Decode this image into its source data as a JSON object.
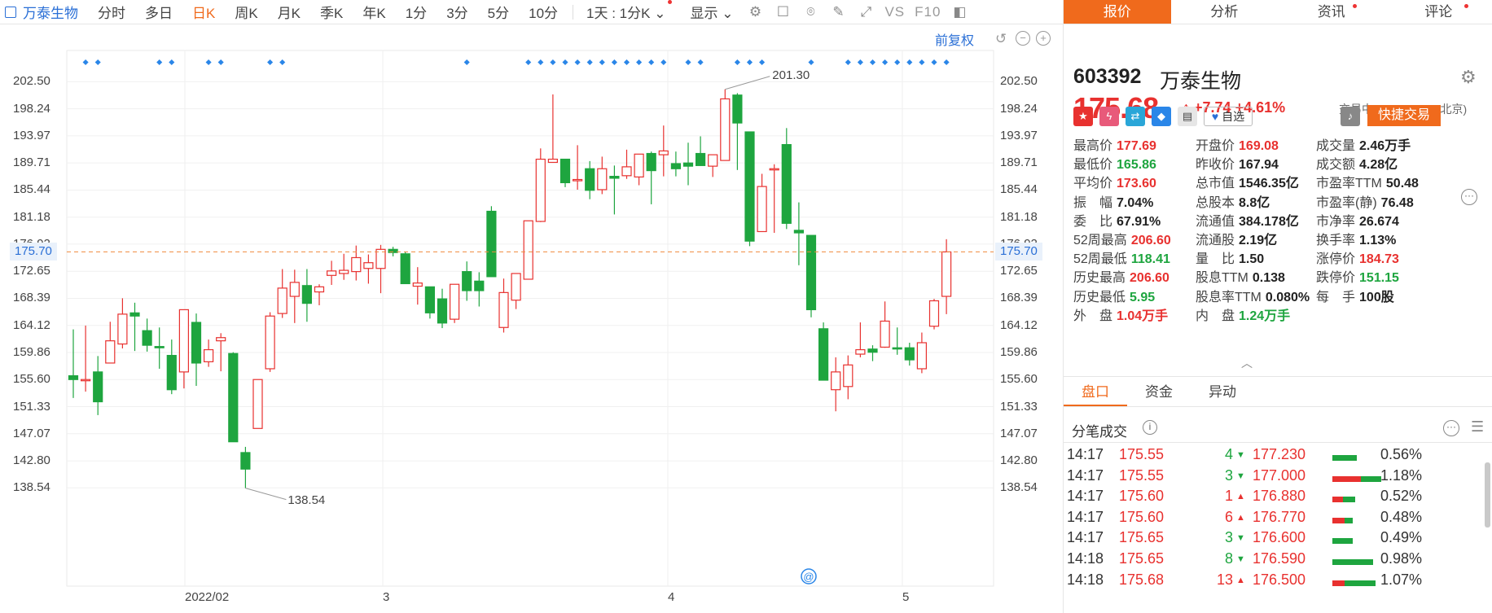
{
  "toolbar": {
    "stock_name": "万泰生物",
    "tabs": [
      "分时",
      "多日",
      "日K",
      "周K",
      "月K",
      "季K",
      "年K",
      "1分",
      "3分",
      "5分",
      "10分"
    ],
    "active_tab": "日K",
    "period_dropdown": "1天 : 1分K",
    "display_dropdown": "显示",
    "vs_label": "VS",
    "f10_label": "F10"
  },
  "chart": {
    "restore_label": "前复权",
    "price_ticks": [
      "202.50",
      "198.24",
      "193.97",
      "189.71",
      "185.44",
      "181.18",
      "176.92",
      "172.65",
      "168.39",
      "164.12",
      "159.86",
      "155.60",
      "151.33",
      "147.07",
      "142.80",
      "138.54"
    ],
    "date_labels": [
      "2022/02",
      "3",
      "4",
      "5"
    ],
    "current_price_tag": "175.70",
    "high_label": "201.30",
    "low_label": "138.54",
    "colors": {
      "up": "#e8312f",
      "down": "#1ea53f",
      "current_line": "#f08a3c",
      "marker": "#2a86e8"
    }
  },
  "chart_data": {
    "type": "candlestick",
    "ylim": [
      136.4,
      204.6
    ],
    "candles": [
      {
        "o": 156.2,
        "c": 155.6,
        "h": 163.5,
        "l": 152.7
      },
      {
        "o": 155.6,
        "c": 155.6,
        "h": 164.1,
        "l": 153.7
      },
      {
        "o": 156.8,
        "c": 152.1,
        "h": 159.3,
        "l": 150.0
      },
      {
        "o": 158.2,
        "c": 161.7,
        "h": 164.7,
        "l": 158.2
      },
      {
        "o": 161.2,
        "c": 165.9,
        "h": 168.4,
        "l": 160.5
      },
      {
        "o": 166.1,
        "c": 165.6,
        "h": 167.7,
        "l": 160.1
      },
      {
        "o": 163.3,
        "c": 161.0,
        "h": 165.2,
        "l": 160.0
      },
      {
        "o": 160.8,
        "c": 160.6,
        "h": 163.8,
        "l": 157.3
      },
      {
        "o": 159.4,
        "c": 154.0,
        "h": 161.9,
        "l": 153.3
      },
      {
        "o": 156.8,
        "c": 166.6,
        "h": 166.6,
        "l": 154.2
      },
      {
        "o": 164.6,
        "c": 158.2,
        "h": 166.0,
        "l": 154.6
      },
      {
        "o": 158.4,
        "c": 160.3,
        "h": 161.9,
        "l": 157.6
      },
      {
        "o": 161.7,
        "c": 162.2,
        "h": 162.9,
        "l": 156.9
      },
      {
        "o": 159.7,
        "c": 145.8,
        "h": 159.9,
        "l": 145.8
      },
      {
        "o": 144.1,
        "c": 141.5,
        "h": 145.0,
        "l": 138.5
      },
      {
        "o": 147.9,
        "c": 155.6,
        "h": 155.6,
        "l": 147.9
      },
      {
        "o": 157.3,
        "c": 165.6,
        "h": 166.2,
        "l": 156.8
      },
      {
        "o": 166.0,
        "c": 170.0,
        "h": 173.0,
        "l": 165.3
      },
      {
        "o": 168.7,
        "c": 170.9,
        "h": 172.9,
        "l": 164.5
      },
      {
        "o": 170.4,
        "c": 167.6,
        "h": 173.0,
        "l": 164.7
      },
      {
        "o": 169.4,
        "c": 170.2,
        "h": 170.6,
        "l": 167.3
      },
      {
        "o": 172.0,
        "c": 172.7,
        "h": 174.3,
        "l": 170.5
      },
      {
        "o": 172.3,
        "c": 172.8,
        "h": 175.4,
        "l": 171.3
      },
      {
        "o": 172.6,
        "c": 174.8,
        "h": 176.7,
        "l": 171.2
      },
      {
        "o": 173.1,
        "c": 174.0,
        "h": 175.3,
        "l": 170.7
      },
      {
        "o": 173.1,
        "c": 176.1,
        "h": 176.8,
        "l": 169.2
      },
      {
        "o": 176.1,
        "c": 175.6,
        "h": 176.5,
        "l": 175.0
      },
      {
        "o": 175.4,
        "c": 170.7,
        "h": 175.7,
        "l": 170.7
      },
      {
        "o": 170.3,
        "c": 170.8,
        "h": 173.3,
        "l": 167.4
      },
      {
        "o": 170.2,
        "c": 166.1,
        "h": 170.2,
        "l": 165.2
      },
      {
        "o": 168.3,
        "c": 164.5,
        "h": 169.9,
        "l": 163.7
      },
      {
        "o": 165.1,
        "c": 170.6,
        "h": 170.6,
        "l": 164.5
      },
      {
        "o": 172.6,
        "c": 169.6,
        "h": 174.2,
        "l": 168.0
      },
      {
        "o": 171.1,
        "c": 169.6,
        "h": 172.5,
        "l": 167.1
      },
      {
        "o": 182.1,
        "c": 171.8,
        "h": 182.9,
        "l": 171.8
      },
      {
        "o": 163.8,
        "c": 169.3,
        "h": 171.5,
        "l": 163.0
      },
      {
        "o": 168.1,
        "c": 172.3,
        "h": 172.3,
        "l": 166.7
      },
      {
        "o": 171.4,
        "c": 180.6,
        "h": 180.6,
        "l": 171.4
      },
      {
        "o": 180.5,
        "c": 190.3,
        "h": 192.0,
        "l": 180.4
      },
      {
        "o": 189.8,
        "c": 190.3,
        "h": 200.5,
        "l": 190.3
      },
      {
        "o": 190.3,
        "c": 186.6,
        "h": 190.3,
        "l": 185.9
      },
      {
        "o": 186.9,
        "c": 187.1,
        "h": 192.5,
        "l": 185.5
      },
      {
        "o": 188.8,
        "c": 185.4,
        "h": 190.0,
        "l": 184.0
      },
      {
        "o": 185.5,
        "c": 188.8,
        "h": 190.7,
        "l": 184.8
      },
      {
        "o": 187.6,
        "c": 187.3,
        "h": 189.3,
        "l": 181.6
      },
      {
        "o": 187.7,
        "c": 189.1,
        "h": 191.8,
        "l": 187.2
      },
      {
        "o": 187.5,
        "c": 191.1,
        "h": 191.1,
        "l": 186.2
      },
      {
        "o": 191.2,
        "c": 188.5,
        "h": 191.5,
        "l": 183.2
      },
      {
        "o": 191.0,
        "c": 191.6,
        "h": 195.6,
        "l": 187.6
      },
      {
        "o": 189.6,
        "c": 188.8,
        "h": 191.5,
        "l": 187.6
      },
      {
        "o": 189.7,
        "c": 189.2,
        "h": 192.9,
        "l": 186.2
      },
      {
        "o": 191.2,
        "c": 189.3,
        "h": 193.9,
        "l": 189.3
      },
      {
        "o": 189.2,
        "c": 191.0,
        "h": 191.0,
        "l": 187.5
      },
      {
        "o": 190.1,
        "c": 199.8,
        "h": 201.3,
        "l": 190.1
      },
      {
        "o": 200.4,
        "c": 196.0,
        "h": 200.7,
        "l": 188.6
      },
      {
        "o": 194.6,
        "c": 177.4,
        "h": 194.6,
        "l": 176.6
      },
      {
        "o": 178.9,
        "c": 186.0,
        "h": 188.0,
        "l": 178.9
      },
      {
        "o": 188.7,
        "c": 188.8,
        "h": 189.5,
        "l": 178.7
      },
      {
        "o": 192.6,
        "c": 180.2,
        "h": 195.2,
        "l": 179.3
      },
      {
        "o": 179.1,
        "c": 178.7,
        "h": 183.5,
        "l": 173.6
      },
      {
        "o": 178.3,
        "c": 166.6,
        "h": 178.3,
        "l": 165.4
      },
      {
        "o": 163.6,
        "c": 155.5,
        "h": 164.6,
        "l": 155.5
      },
      {
        "o": 154.0,
        "c": 156.8,
        "h": 159.1,
        "l": 150.6
      },
      {
        "o": 154.5,
        "c": 157.9,
        "h": 159.4,
        "l": 152.5
      },
      {
        "o": 159.6,
        "c": 160.3,
        "h": 164.6,
        "l": 159.1
      },
      {
        "o": 160.4,
        "c": 159.9,
        "h": 161.0,
        "l": 158.5
      },
      {
        "o": 160.7,
        "c": 164.8,
        "h": 167.9,
        "l": 160.6
      },
      {
        "o": 160.6,
        "c": 160.5,
        "h": 163.8,
        "l": 159.5
      },
      {
        "o": 160.6,
        "c": 158.7,
        "h": 161.4,
        "l": 157.8
      },
      {
        "o": 157.3,
        "c": 161.4,
        "h": 163.0,
        "l": 156.6
      },
      {
        "o": 164.0,
        "c": 168.0,
        "h": 168.3,
        "l": 163.5
      },
      {
        "o": 168.7,
        "c": 175.7,
        "h": 177.7,
        "l": 165.9
      }
    ],
    "marker_columns": [
      1,
      2,
      7,
      8,
      11,
      12,
      16,
      17,
      32,
      37,
      38,
      39,
      40,
      41,
      42,
      43,
      44,
      45,
      46,
      47,
      48,
      50,
      51,
      54,
      55,
      56,
      60,
      63,
      64,
      65,
      66,
      67,
      68,
      69,
      70,
      71
    ]
  },
  "panel": {
    "tabs": [
      "报价",
      "分析",
      "资讯",
      "评论"
    ],
    "code": "603392",
    "name": "万泰生物",
    "price": "175.68",
    "change": "+7.74",
    "change_pct": "+4.61%",
    "status": "交易中 05/12 14:18(北京)",
    "zixuan_label": "自选",
    "quick_trade": "快捷交易",
    "stats": [
      [
        {
          "k": "最高价",
          "v": "177.69",
          "c": "red"
        },
        {
          "k": "开盘价",
          "v": "169.08",
          "c": "red"
        },
        {
          "k": "成交量",
          "v": "2.46万手",
          "c": ""
        }
      ],
      [
        {
          "k": "最低价",
          "v": "165.86",
          "c": "green"
        },
        {
          "k": "昨收价",
          "v": "167.94",
          "c": ""
        },
        {
          "k": "成交额",
          "v": "4.28亿",
          "c": ""
        }
      ],
      [
        {
          "k": "平均价",
          "v": "173.60",
          "c": "red"
        },
        {
          "k": "总市值",
          "v": "1546.35亿",
          "c": ""
        },
        {
          "k": "市盈率TTM",
          "v": "50.48",
          "c": ""
        }
      ],
      [
        {
          "k": "振　幅",
          "v": "7.04%",
          "c": ""
        },
        {
          "k": "总股本",
          "v": "8.8亿",
          "c": ""
        },
        {
          "k": "市盈率(静)",
          "v": "76.48",
          "c": ""
        }
      ],
      [
        {
          "k": "委　比",
          "v": "67.91%",
          "c": ""
        },
        {
          "k": "流通值",
          "v": "384.178亿",
          "c": ""
        },
        {
          "k": "市净率",
          "v": "26.674",
          "c": ""
        }
      ],
      [
        {
          "k": "52周最高",
          "v": "206.60",
          "c": "red"
        },
        {
          "k": "流通股",
          "v": "2.19亿",
          "c": ""
        },
        {
          "k": "换手率",
          "v": "1.13%",
          "c": ""
        }
      ],
      [
        {
          "k": "52周最低",
          "v": "118.41",
          "c": "green"
        },
        {
          "k": "量　比",
          "v": "1.50",
          "c": ""
        },
        {
          "k": "涨停价",
          "v": "184.73",
          "c": "red"
        }
      ],
      [
        {
          "k": "历史最高",
          "v": "206.60",
          "c": "red"
        },
        {
          "k": "股息TTM",
          "v": "0.138",
          "c": ""
        },
        {
          "k": "跌停价",
          "v": "151.15",
          "c": "green"
        }
      ],
      [
        {
          "k": "历史最低",
          "v": "5.95",
          "c": "green"
        },
        {
          "k": "股息率TTM",
          "v": "0.080%",
          "c": ""
        },
        {
          "k": "每　手",
          "v": "100股",
          "c": ""
        }
      ],
      [
        {
          "k": "外　盘",
          "v": "1.04万手",
          "c": "red"
        },
        {
          "k": "内　盘",
          "v": "1.24万手",
          "c": "green"
        }
      ]
    ],
    "subtabs": [
      "盘口",
      "资金",
      "异动"
    ],
    "trades_title": "分笔成交",
    "trades": [
      {
        "t": "14:17",
        "p": "175.55",
        "v": "4",
        "dir": "down",
        "pp": "177.230",
        "bar": 0.12,
        "red": 0.0,
        "pct": "0.56%"
      },
      {
        "t": "14:17",
        "p": "175.55",
        "v": "3",
        "dir": "down",
        "pp": "177.000",
        "bar": 0.24,
        "red": 0.14,
        "pct": "1.18%"
      },
      {
        "t": "14:17",
        "p": "175.60",
        "v": "1",
        "dir": "up",
        "pp": "176.880",
        "bar": 0.11,
        "red": 0.05,
        "pct": "0.52%"
      },
      {
        "t": "14:17",
        "p": "175.60",
        "v": "6",
        "dir": "up",
        "pp": "176.770",
        "bar": 0.1,
        "red": 0.06,
        "pct": "0.48%"
      },
      {
        "t": "14:17",
        "p": "175.65",
        "v": "3",
        "dir": "down",
        "pp": "176.600",
        "bar": 0.1,
        "red": 0.0,
        "pct": "0.49%"
      },
      {
        "t": "14:18",
        "p": "175.65",
        "v": "8",
        "dir": "down",
        "pp": "176.590",
        "bar": 0.2,
        "red": 0.0,
        "pct": "0.98%"
      },
      {
        "t": "14:18",
        "p": "175.68",
        "v": "13",
        "dir": "up",
        "pp": "176.500",
        "bar": 0.21,
        "red": 0.06,
        "pct": "1.07%"
      }
    ]
  }
}
